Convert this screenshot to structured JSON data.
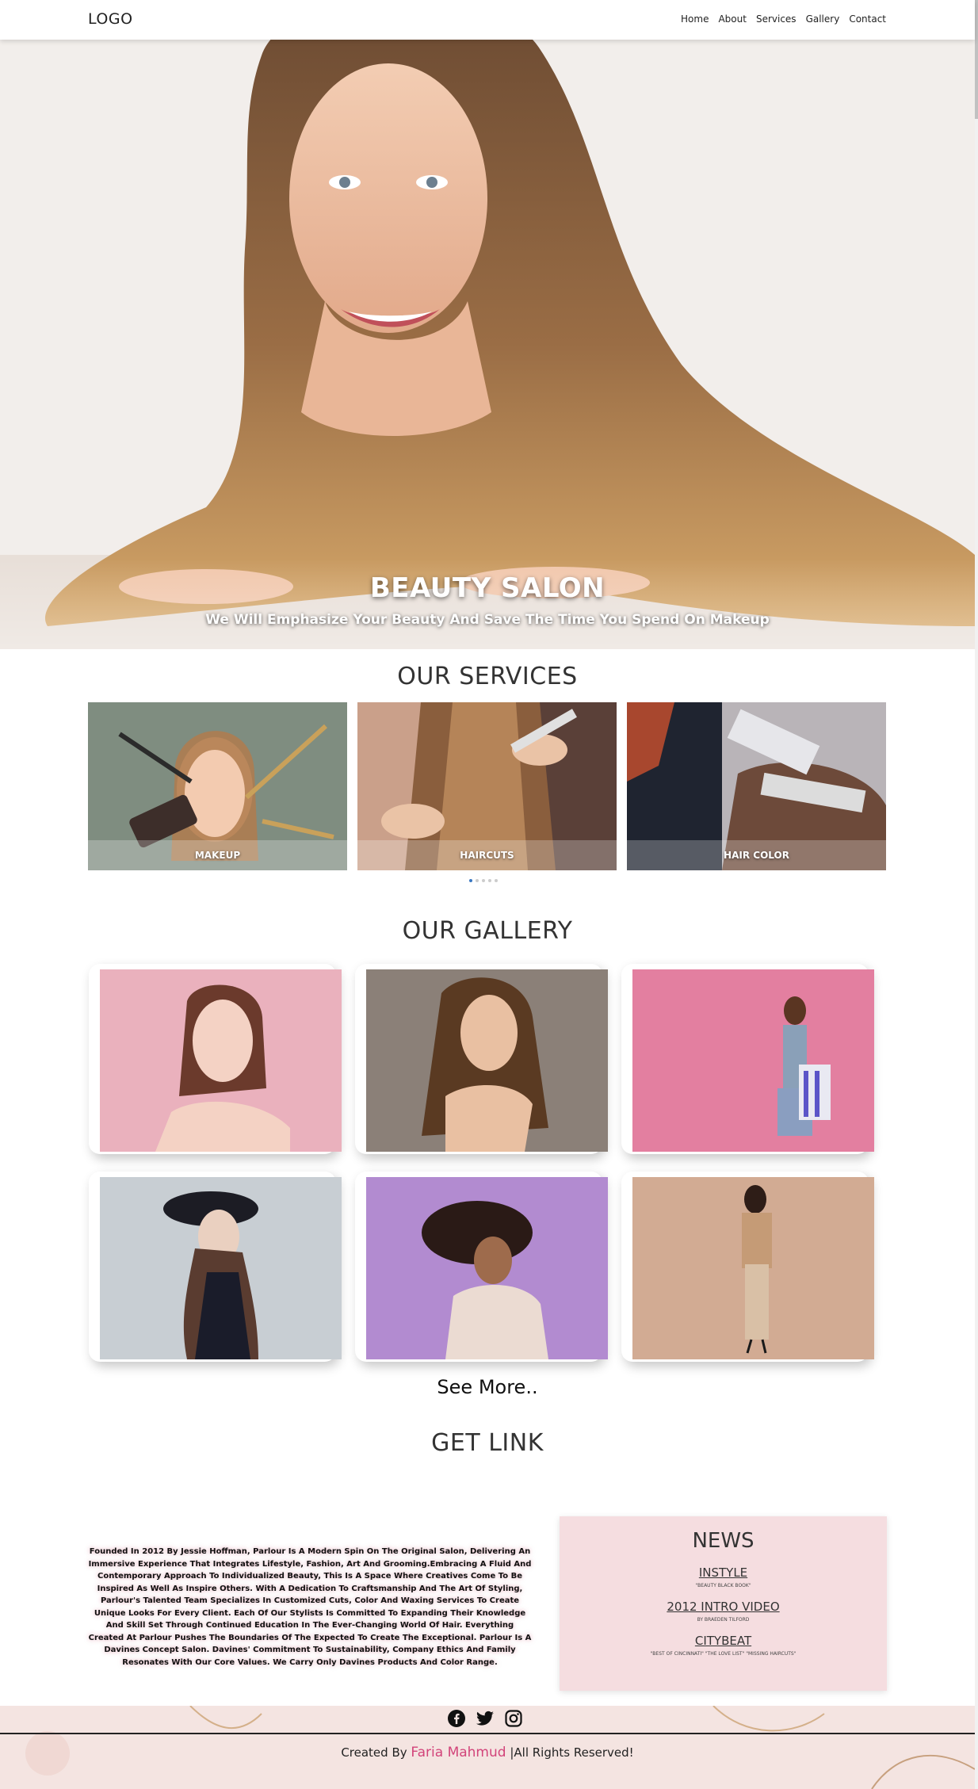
{
  "nav": {
    "logo": "LOGO",
    "links": [
      "Home",
      "About",
      "Services",
      "Gallery",
      "Contact"
    ]
  },
  "hero": {
    "title": "BEAUTY SALON",
    "subtitle": "We Will Emphasize Your Beauty And Save The Time You Spend On Makeup"
  },
  "services": {
    "title": "OUR SERVICES",
    "cards": [
      {
        "label": "MAKEUP"
      },
      {
        "label": "HAIRCUTS"
      },
      {
        "label": "HAIR COLOR"
      }
    ],
    "carousel_pages": 5,
    "active_page": 1
  },
  "gallery": {
    "title": "OUR GALLERY",
    "see_more": "See More.."
  },
  "get_link": {
    "title": "GET LINK"
  },
  "about": {
    "text": "Founded In 2012 By Jessie Hoffman, Parlour Is A Modern Spin On The Original Salon, Delivering An Immersive Experience That Integrates Lifestyle, Fashion, Art And Grooming.Embracing A Fluid And Contemporary Approach To Individualized Beauty, This Is A Space Where Creatives Come To Be Inspired As Well As Inspire Others. With A Dedication To Craftsmanship And The Art Of Styling, Parlour's Talented Team Specializes In Customized Cuts, Color And Waxing Services To Create Unique Looks For Every Client. Each Of Our Stylists Is Committed To Expanding Their Knowledge And Skill Set Through Continued Education In The Ever-Changing World Of Hair. Everything Created At Parlour Pushes The Boundaries Of The Expected To Create The Exceptional. Parlour Is A Davines Concept Salon. Davines' Commitment To Sustainability, Company Ethics And Family Resonates With Our Core Values. We Carry Only Davines Products And Color Range."
  },
  "news": {
    "title": "NEWS",
    "items": [
      {
        "link": "INSTYLE",
        "sub": "\"BEAUTY BLACK BOOK\""
      },
      {
        "link": "2012 INTRO VIDEO",
        "sub": "BY BRAEDEN TILFORD"
      },
      {
        "link": "CITYBEAT",
        "sub": "\"BEST OF CINCINNATI\" \"THE LOVE LIST\" \"MISSING HAIRCUTS\""
      }
    ]
  },
  "footer": {
    "social_icons": [
      "facebook-icon",
      "twitter-icon",
      "instagram-icon"
    ],
    "credit_prefix": "Created By",
    "author": "Faria Mahmud",
    "credit_suffix": "|All Rights Reserved!"
  },
  "colors": {
    "accent_pink": "#d2447a",
    "news_bg": "#f5dde0",
    "footer_bg": "#f4e4e1",
    "active_dot": "#3a78c2"
  }
}
